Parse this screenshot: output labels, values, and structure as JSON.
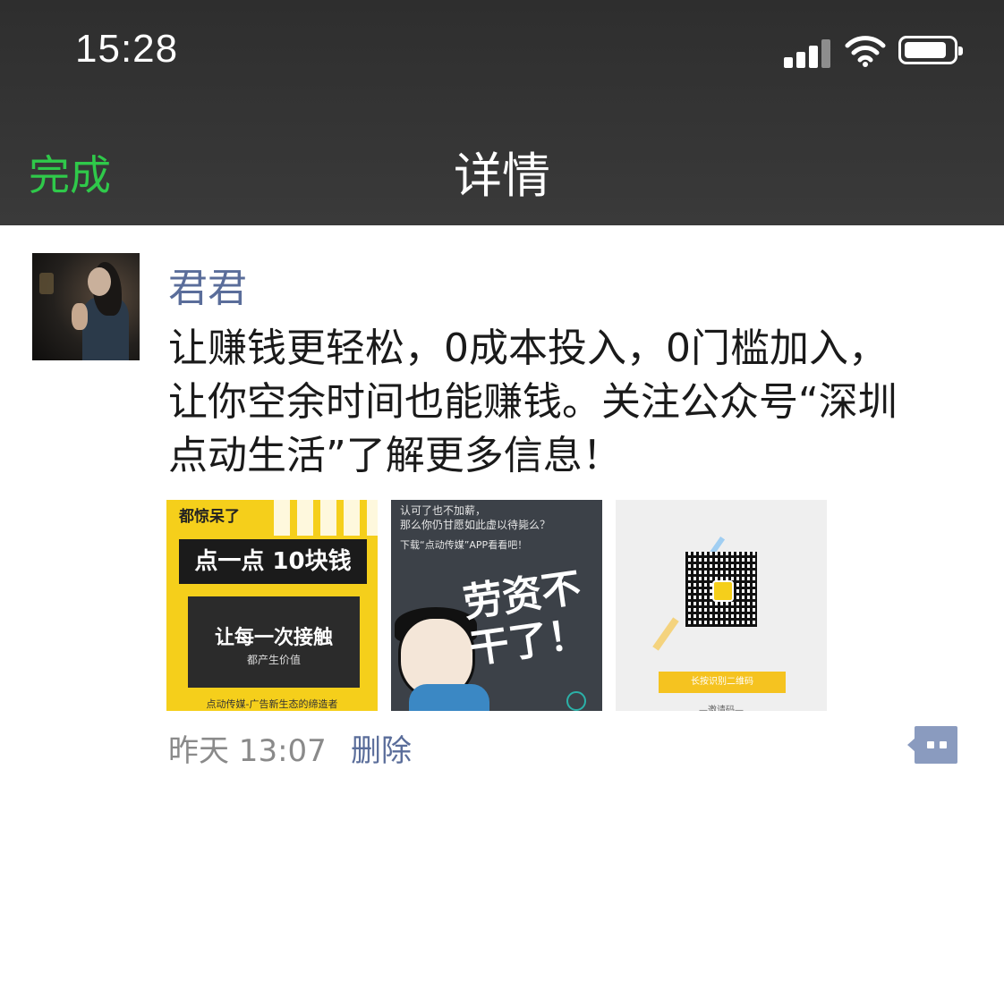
{
  "status_bar": {
    "time": "15:28"
  },
  "nav": {
    "done_label": "完成",
    "title": "详情"
  },
  "post": {
    "author": "君君",
    "text_lines": [
      "让赚钱更轻松，0成本投入，0门槛加入，",
      "让你空余时间也能赚钱。关注公众号“深圳",
      "点动生活”了解更多信息！"
    ],
    "images": {
      "img1": {
        "tag": "都惊呆了",
        "headline": "点一点 10块钱",
        "box_title": "让每一次接触",
        "box_sub": "都产生价值",
        "footer": "点动传媒-广告新生态的缔造者"
      },
      "img2": {
        "line1": "认可了也不加薪，",
        "line2": "那么你仍甘愿如此虚以待毙么？",
        "line3": "下载“点动传媒”APP看看吧！",
        "big_text": "劳资不干了！"
      },
      "img3": {
        "button": "长按识别二维码",
        "under": "—邀请码—"
      }
    },
    "timestamp": "昨天 13:07",
    "delete_label": "删除"
  },
  "colors": {
    "accent_green": "#2fc94a",
    "link_blue": "#5a6d9a",
    "bar_bg": "#333333"
  },
  "icons": [
    "signal-icon",
    "wifi-icon",
    "battery-icon",
    "comment-icon"
  ]
}
